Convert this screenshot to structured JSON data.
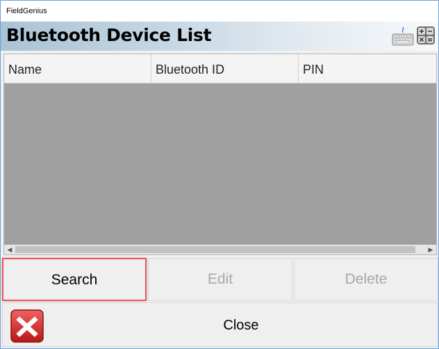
{
  "window": {
    "title": "FieldGenius"
  },
  "header": {
    "title": "Bluetooth Device List",
    "icons": [
      "keyboard-icon",
      "calculator-icon"
    ]
  },
  "table": {
    "columns": [
      "Name",
      "Bluetooth ID",
      "PIN"
    ],
    "rows": []
  },
  "buttons": {
    "search_label": "Search",
    "edit_label": "Edit",
    "delete_label": "Delete",
    "close_label": "Close"
  },
  "colors": {
    "highlight": "#e05a5a",
    "close_icon_red": "#d62b2b",
    "table_body": "#a0a0a0"
  }
}
